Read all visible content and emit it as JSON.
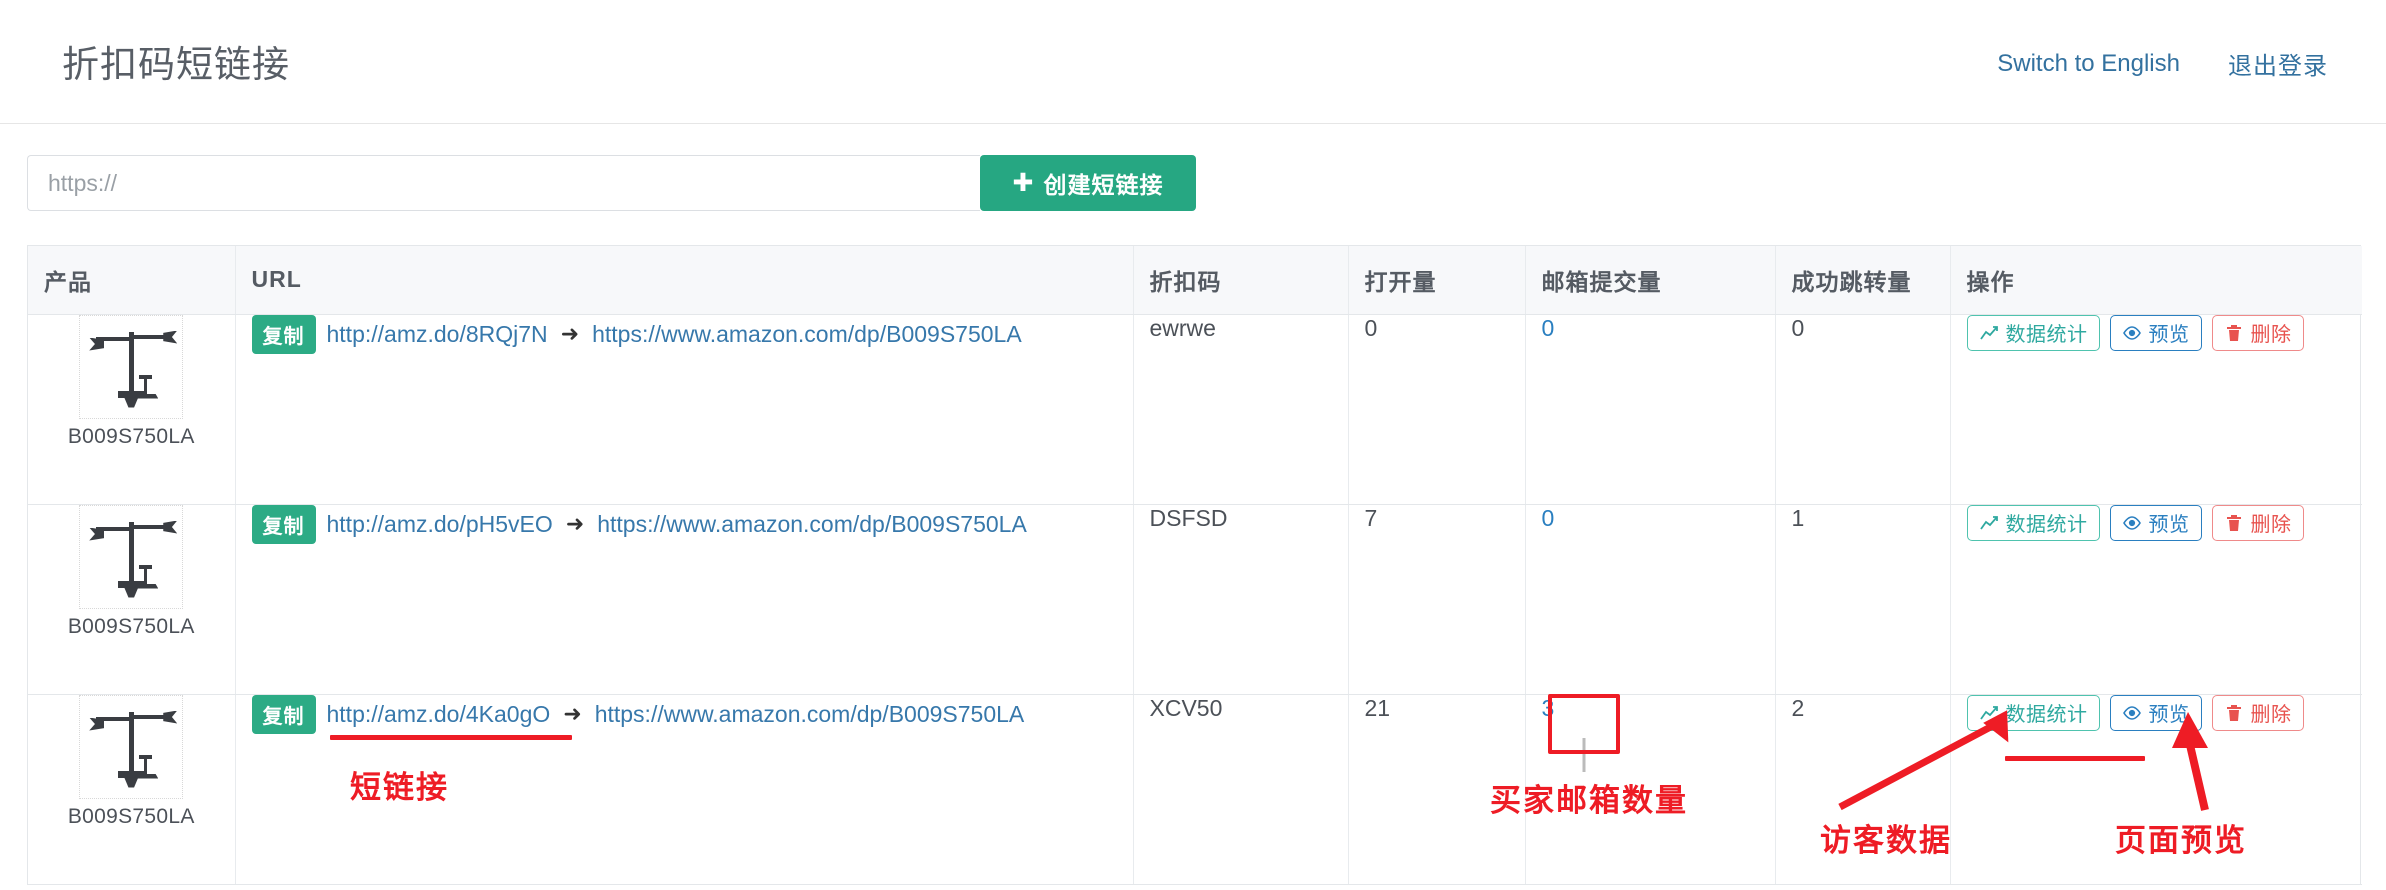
{
  "header": {
    "title": "折扣码短链接",
    "switch_language_label": "Switch to English",
    "logout_label": "退出登录"
  },
  "toolbar": {
    "url_placeholder": "https://",
    "url_value": "",
    "create_label": "创建短链接",
    "create_icon": "plus-icon",
    "plus_glyph": "✚"
  },
  "table": {
    "columns": [
      {
        "key": "product",
        "label": "产品"
      },
      {
        "key": "url",
        "label": "URL"
      },
      {
        "key": "code",
        "label": "折扣码"
      },
      {
        "key": "opens",
        "label": "打开量"
      },
      {
        "key": "emails",
        "label": "邮箱提交量"
      },
      {
        "key": "redirects",
        "label": "成功跳转量"
      },
      {
        "key": "actions",
        "label": "操作"
      }
    ],
    "copy_badge_label": "复制",
    "arrow_glyph": "➜",
    "actions": {
      "stats_label": "数据统计",
      "stats_icon": "chart-line-icon",
      "preview_label": "预览",
      "preview_icon": "eye-icon",
      "delete_label": "删除",
      "delete_icon": "trash-icon"
    },
    "rows": [
      {
        "product_asin": "B009S750LA",
        "product_image": "monitor-mount-thumbnail",
        "short_url": "http://amz.do/8RQj7N",
        "long_url": "https://www.amazon.com/dp/B009S750LA",
        "code": "ewrwe",
        "opens": "0",
        "emails": "0",
        "redirects": "0"
      },
      {
        "product_asin": "B009S750LA",
        "product_image": "monitor-mount-thumbnail",
        "short_url": "http://amz.do/pH5vEO",
        "long_url": "https://www.amazon.com/dp/B009S750LA",
        "code": "DSFSD",
        "opens": "7",
        "emails": "0",
        "redirects": "1"
      },
      {
        "product_asin": "B009S750LA",
        "product_image": "monitor-mount-thumbnail",
        "short_url": "http://amz.do/4Ka0gO",
        "long_url": "https://www.amazon.com/dp/B009S750LA",
        "code": "XCV50",
        "opens": "21",
        "emails": "3",
        "redirects": "2"
      }
    ]
  },
  "annotations": [
    {
      "id": "short-link",
      "text": "短链接"
    },
    {
      "id": "buyer-email-count",
      "text": "买家邮箱数量"
    },
    {
      "id": "visitor-data",
      "text": "访客数据"
    },
    {
      "id": "page-preview",
      "text": "页面预览"
    }
  ],
  "colors": {
    "accent_green": "#26a782",
    "badge_green": "#2cab85",
    "link_blue": "#3778ab",
    "annotation_red": "#ee1c25",
    "header_link_blue": "#33719f",
    "stats_teal": "#2fa9a0",
    "delete_red": "#e8534f"
  }
}
